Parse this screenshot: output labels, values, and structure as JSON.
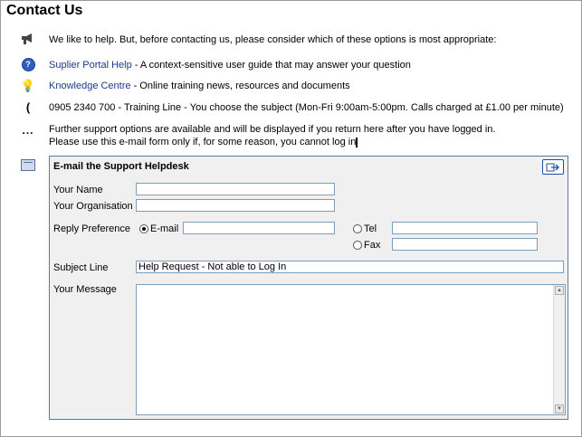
{
  "page": {
    "title": "Contact Us"
  },
  "intro": {
    "text": "We like to help.  But, before contacting us, please consider which of these options is most appropriate:"
  },
  "options": {
    "portal": {
      "link": "Suplier Portal Help",
      "desc": " - A context-sensitive user guide that may answer your question"
    },
    "knowledge": {
      "link": "Knowledge Centre",
      "desc": " - Online training news, resources and documents"
    },
    "phone": {
      "text": "0905 2340 700 - Training Line - You choose the subject (Mon-Fri 9:00am-5:00pm. Calls charged at £1.00 per minute)"
    },
    "further": {
      "line1": "Further support options are available and will be displayed if you return here after you have logged in.",
      "line2": "Please use this e-mail form only if, for some reason, you cannot log in"
    }
  },
  "form": {
    "title": "E-mail the Support Helpdesk",
    "labels": {
      "name": "Your Name",
      "organisation": "Your Organisation",
      "reply": "Reply Preference",
      "email": "E-mail",
      "tel": "Tel",
      "fax": "Fax",
      "subject": "Subject Line",
      "message": "Your Message"
    },
    "values": {
      "name": "",
      "organisation": "",
      "email": "",
      "tel": "",
      "fax": "",
      "subject": "Help Request - Not able to Log In",
      "message": ""
    },
    "reply_selected": "email"
  },
  "icons": {
    "megaphone": "megaphone-icon",
    "help": "help-icon",
    "bulb": "lightbulb-icon",
    "phone": "phone-icon",
    "dots": "more-icon",
    "mail": "mail-tray-icon",
    "send": "send-icon"
  },
  "colors": {
    "link": "#1a3a8a",
    "panel_border": "#5b7aa3",
    "panel_bg": "#f0f0f0",
    "field_border": "#7f9db9"
  }
}
